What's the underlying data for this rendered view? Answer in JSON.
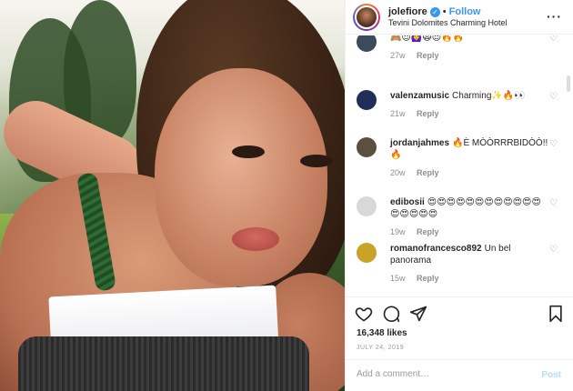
{
  "post": {
    "username": "jolefiore",
    "verified_badge": "✓",
    "separator": "•",
    "follow_label": "Follow",
    "location": "Tevini Dolomites Charming Hotel",
    "more_label": "···"
  },
  "comments": [
    {
      "user": "",
      "text": "🙈😈🙆‍♀️🙀😍🔥🔥",
      "age": "27w",
      "reply": "Reply",
      "avatar_color": "#3b4a5c"
    },
    {
      "user": "valenzamusic",
      "text": "Charming✨🔥👀",
      "age": "21w",
      "reply": "Reply",
      "avatar_color": "#1f2f5a"
    },
    {
      "user": "jordanjahmes",
      "text": "🔥È MÒÒRRRBIDÒÒ!!🔥",
      "age": "20w",
      "reply": "Reply",
      "avatar_color": "#5b5040"
    },
    {
      "user": "edibosii",
      "text": "😍😍😍😍😍😍😍😍😍😍😍😍😍😍😍😍😍",
      "age": "19w",
      "reply": "Reply",
      "avatar_color": "#d8d8d8"
    },
    {
      "user": "romanofrancesco892",
      "text": "Un bel panorama",
      "age": "15w",
      "reply": "Reply",
      "avatar_color": "#c9a227"
    }
  ],
  "icons": {
    "heart": "heart-icon",
    "comment": "comment-icon",
    "share": "share-icon",
    "save": "bookmark-icon"
  },
  "likes": "16,348 likes",
  "date": "JULY 24, 2019",
  "add_comment": {
    "placeholder": "Add a comment…",
    "post_label": "Post"
  },
  "colors": {
    "accent": "#3897f0",
    "post_disabled": "#b2dffc",
    "muted": "#8e8e8e"
  }
}
